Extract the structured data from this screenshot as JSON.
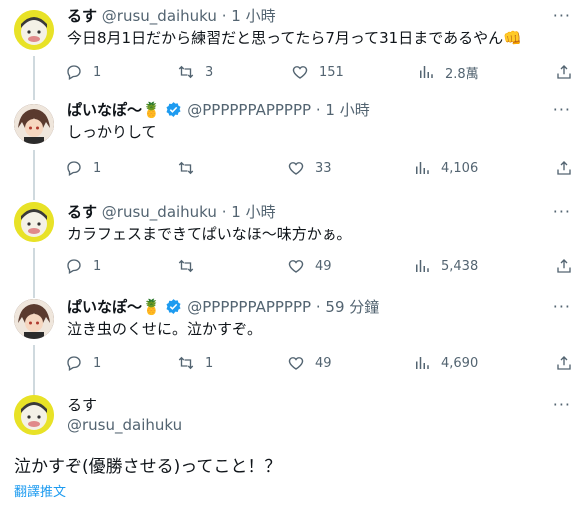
{
  "thread": [
    {
      "name": "るす",
      "handle": "@rusu_daihuku",
      "time": "1 小時",
      "text": "今日8月1日だから練習だと思ってたら7月って31日まであるやん👊",
      "replies": "1",
      "retweets": "3",
      "likes": "151",
      "views": "2.8萬"
    },
    {
      "name": "ぱいなぽ〜🍍",
      "handle": "@PPPPPPAPPPPP",
      "time": "1 小時",
      "text": "しっかりして",
      "replies": "1",
      "retweets": "",
      "likes": "33",
      "views": "4,106"
    },
    {
      "name": "るす",
      "handle": "@rusu_daihuku",
      "time": "1 小時",
      "text": "カラフェスまできてぱいなほ〜味方かぁ。",
      "replies": "1",
      "retweets": "",
      "likes": "49",
      "views": "5,438"
    },
    {
      "name": "ぱいなぽ〜🍍",
      "handle": "@PPPPPPAPPPPP",
      "time": "59 分鐘",
      "text": "泣き虫のくせに。泣かすぞ。",
      "replies": "1",
      "retweets": "1",
      "likes": "49",
      "views": "4,690"
    }
  ],
  "main": {
    "name": "るす",
    "handle": "@rusu_daihuku",
    "text": "泣かすぞ(優勝させる)ってこと！？",
    "translate": "翻譯推文"
  },
  "separator": "·",
  "colors": {
    "accent": "#1d9bf0",
    "muted": "#536471",
    "line": "#cfd9de",
    "rusu_avatar": "#e8e227"
  },
  "icons": [
    "reply-icon",
    "retweet-icon",
    "like-icon",
    "views-icon",
    "share-icon",
    "more-icon",
    "verified-icon"
  ]
}
